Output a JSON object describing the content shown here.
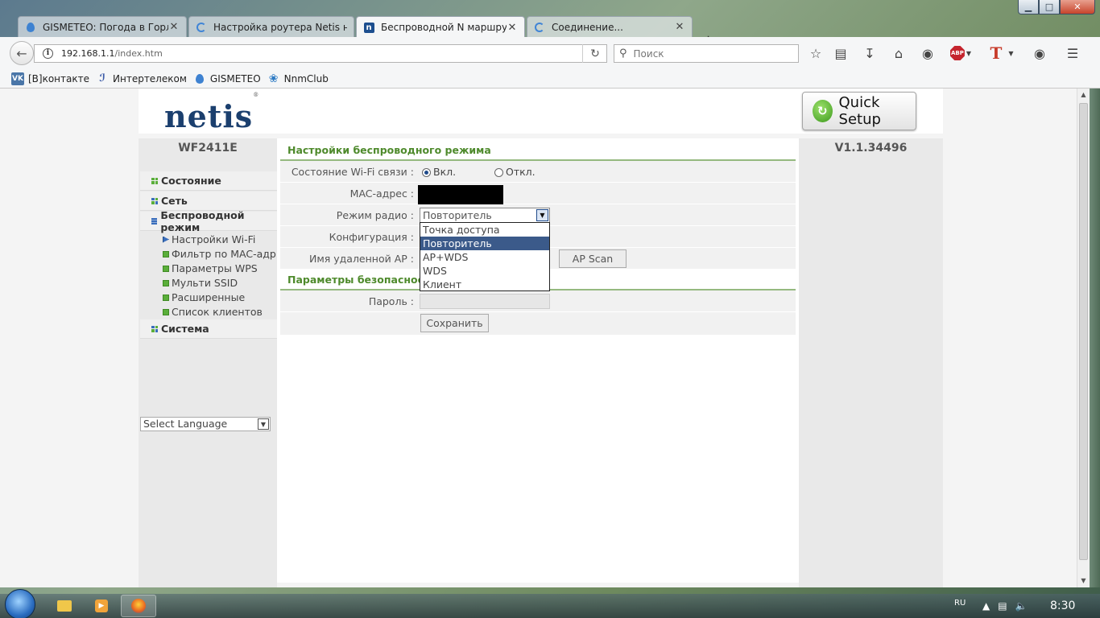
{
  "window": {
    "min_glyph": "▁",
    "max_glyph": "□",
    "close_glyph": "✕"
  },
  "tabs": [
    {
      "title": "GISMETEO: Погода в Горло...",
      "icon": "gismeteo-drop-icon",
      "active": false
    },
    {
      "title": "Настройка роутера Netis н...",
      "icon": "loading-spinner-icon",
      "active": false
    },
    {
      "title": "Беспроводной N маршрут...",
      "icon": "netis-n-icon",
      "active": true
    },
    {
      "title": "Соединение...",
      "icon": "loading-spinner-icon",
      "active": false
    }
  ],
  "toolbar": {
    "url_host": "192.168.1.1",
    "url_path": "/index.htm",
    "search_placeholder": "Поиск",
    "abp_label": "ABP",
    "t_label": "T"
  },
  "bookmarks": [
    {
      "label": "[В]контакте",
      "icon": "vk-icon"
    },
    {
      "label": "Интертелеком",
      "icon": "intertelecom-icon"
    },
    {
      "label": "GISMETEO",
      "icon": "gismeteo-drop-icon"
    },
    {
      "label": "NnmClub",
      "icon": "butterfly-icon"
    }
  ],
  "router": {
    "logo": "netis",
    "logo_mark": "®",
    "quick_setup": "Quick Setup",
    "model": "WF2411E",
    "version": "V1.1.34496",
    "menu": {
      "status": "Состояние",
      "network": "Сеть",
      "wireless": "Беспроводной режим",
      "wireless_sub": [
        "Настройки Wi-Fi",
        "Фильтр по MAC-адр.",
        "Параметры WPS",
        "Мульти SSID",
        "Расширенные",
        "Список клиентов"
      ],
      "system": "Система"
    },
    "language_select": "Select Language",
    "wireless_section_title": "Настройки беспроводного режима",
    "wifi_state_label": "Состояние Wi-Fi связи :",
    "wifi_on": "Вкл.",
    "wifi_off": "Откл.",
    "mac_label": "MAC-адрес :",
    "radio_mode_label": "Режим радио :",
    "radio_mode_value": "Повторитель",
    "config_label": "Конфигурация :",
    "remote_ap_label": "Имя удаленной AP :",
    "ap_scan": "AP Scan",
    "security_section_title": "Параметры безопасности",
    "password_label": "Пароль :",
    "save": "Сохранить",
    "radio_mode_options": [
      "Точка доступа",
      "Повторитель",
      "AP+WDS",
      "WDS",
      "Клиент"
    ],
    "radio_mode_selected_index": 1
  },
  "taskbar": {
    "lang": "RU",
    "clock": "8:30"
  }
}
